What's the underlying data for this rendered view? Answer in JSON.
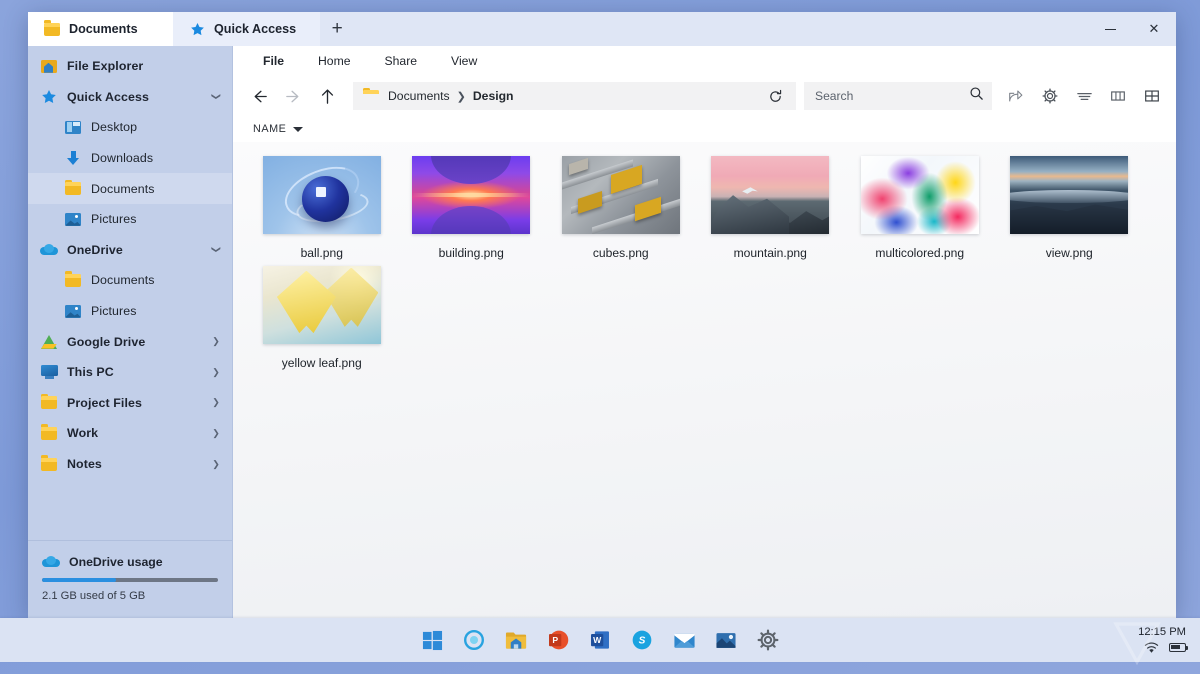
{
  "window": {
    "controls": {
      "minimize": "–",
      "close": "✕"
    }
  },
  "tabs": [
    {
      "label": "Documents",
      "icon": "folder-icon",
      "active": true
    },
    {
      "label": "Quick Access",
      "icon": "star-icon",
      "active": false
    }
  ],
  "new_tab_label": "+",
  "menubar": [
    {
      "label": "File",
      "active": true
    },
    {
      "label": "Home",
      "active": false
    },
    {
      "label": "Share",
      "active": false
    },
    {
      "label": "View",
      "active": false
    }
  ],
  "toolbar": {
    "back_icon": "back-arrow-icon",
    "forward_icon": "forward-arrow-icon",
    "up_icon": "up-arrow-icon",
    "refresh_icon": "refresh-icon",
    "breadcrumb": [
      "Documents",
      "Design"
    ],
    "breadcrumb_separator": "❯",
    "search_placeholder": "Search",
    "search_value": "",
    "right_icons": [
      "share-icon",
      "gear-icon",
      "sort-lines-icon",
      "columns-view-icon",
      "grid-view-icon"
    ]
  },
  "column_header": {
    "name": "NAME",
    "sort_direction": "desc"
  },
  "sidebar": {
    "items": [
      {
        "label": "File Explorer",
        "icon": "file-explorer-icon",
        "level": 0,
        "chevron": "none",
        "selected": false
      },
      {
        "label": "Quick Access",
        "icon": "star-icon",
        "level": 0,
        "chevron": "down",
        "selected": false
      },
      {
        "label": "Desktop",
        "icon": "desktop-icon",
        "level": 1,
        "chevron": "none",
        "selected": false
      },
      {
        "label": "Downloads",
        "icon": "download-icon",
        "level": 1,
        "chevron": "none",
        "selected": false
      },
      {
        "label": "Documents",
        "icon": "folder-icon",
        "level": 1,
        "chevron": "none",
        "selected": true
      },
      {
        "label": "Pictures",
        "icon": "picture-icon",
        "level": 1,
        "chevron": "none",
        "selected": false
      },
      {
        "label": "OneDrive",
        "icon": "cloud-icon",
        "level": 0,
        "chevron": "down",
        "selected": false
      },
      {
        "label": "Documents",
        "icon": "folder-icon",
        "level": 1,
        "chevron": "none",
        "selected": false
      },
      {
        "label": "Pictures",
        "icon": "picture-icon",
        "level": 1,
        "chevron": "none",
        "selected": false
      },
      {
        "label": "Google Drive",
        "icon": "google-drive-icon",
        "level": 0,
        "chevron": "right",
        "selected": false
      },
      {
        "label": "This PC",
        "icon": "this-pc-icon",
        "level": 0,
        "chevron": "right",
        "selected": false
      },
      {
        "label": "Project Files",
        "icon": "folder-icon",
        "level": 0,
        "chevron": "right",
        "selected": false
      },
      {
        "label": "Work",
        "icon": "folder-icon",
        "level": 0,
        "chevron": "right",
        "selected": false
      },
      {
        "label": "Notes",
        "icon": "folder-icon",
        "level": 0,
        "chevron": "right",
        "selected": false
      }
    ],
    "usage": {
      "title": "OneDrive usage",
      "icon": "cloud-icon",
      "detail": "2.1 GB used of 5 GB",
      "percent": 42
    }
  },
  "files": [
    {
      "name": "ball.png",
      "art": "ball"
    },
    {
      "name": "building.png",
      "art": "building"
    },
    {
      "name": "cubes.png",
      "art": "cubes"
    },
    {
      "name": "mountain.png",
      "art": "mountain"
    },
    {
      "name": "multicolored.png",
      "art": "multi"
    },
    {
      "name": "view.png",
      "art": "view"
    },
    {
      "name": "yellow leaf.png",
      "art": "leaf"
    }
  ],
  "taskbar": {
    "icons": [
      "windows-start-icon",
      "cortana-icon",
      "file-explorer-icon",
      "powerpoint-icon",
      "word-icon",
      "skype-icon",
      "mail-icon",
      "photos-icon",
      "settings-gear-icon"
    ],
    "clock": "12:15 PM",
    "tray_icons": [
      "wifi-icon",
      "battery-icon"
    ]
  },
  "colors": {
    "desktop": "#84a0da",
    "sidebar": "#c2cfe9",
    "accent": "#1b8ae0",
    "taskbar": "#dbe3f3",
    "tab_inactive": "#e9eefa",
    "tabstrip": "#dfe6f5"
  }
}
